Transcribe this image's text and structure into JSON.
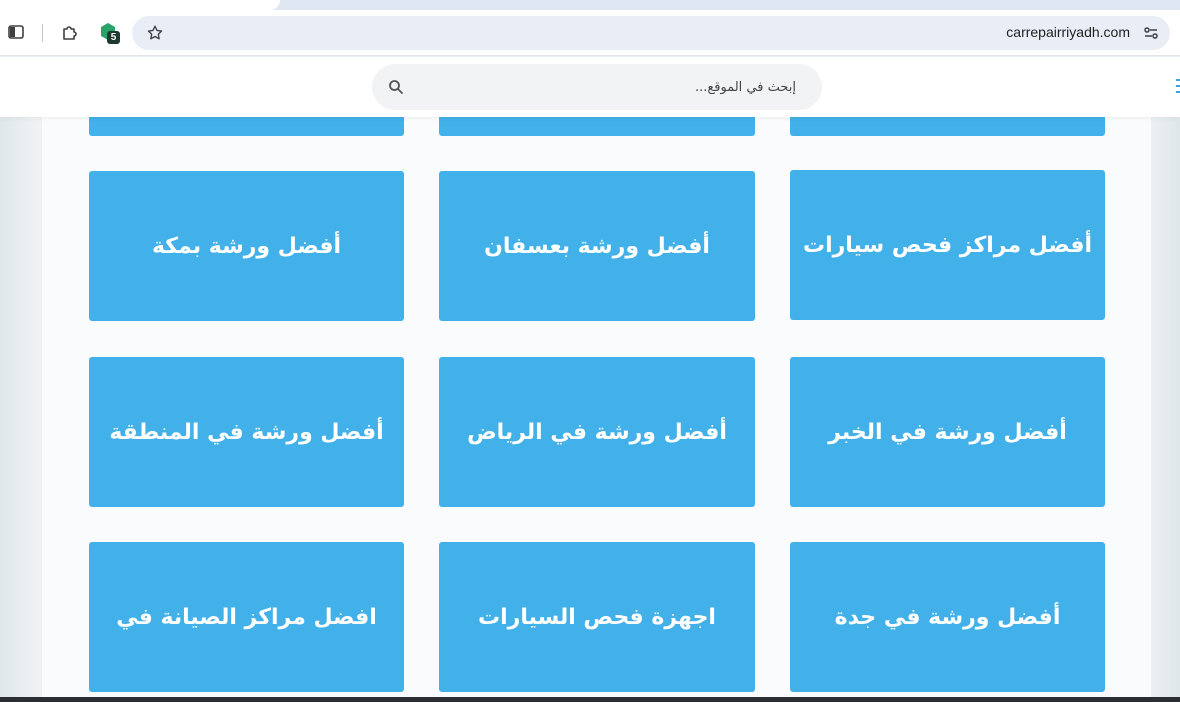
{
  "browser": {
    "url": "carrepairriyadh.com",
    "extension_badge": "5",
    "icons": {
      "sidebar": "sidebar-toggle-icon",
      "extensions": "puzzle-icon",
      "extension_app": "green-hexagon-extension-icon",
      "bookmark": "star-icon",
      "site_settings": "tune-icon"
    }
  },
  "site": {
    "search": {
      "placeholder": "إبحث في الموقع..."
    }
  },
  "cards": [
    {
      "title": ""
    },
    {
      "title": ""
    },
    {
      "title": ""
    },
    {
      "title": "أفضل ورشة بمكة"
    },
    {
      "title": "أفضل ورشة بعسفان"
    },
    {
      "title": "أفضل مراكز فحص سيارات"
    },
    {
      "title": "أفضل ورشة في المنطقة"
    },
    {
      "title": "أفضل ورشة في الرياض"
    },
    {
      "title": "أفضل ورشة في الخبر"
    },
    {
      "title": "افضل مراكز الصيانة في"
    },
    {
      "title": "اجهزة فحص السيارات"
    },
    {
      "title": "أفضل ورشة في جدة"
    }
  ],
  "colors": {
    "card": "#42b1e9",
    "card_text": "#ffffff",
    "accent": "#3aa5e0"
  }
}
